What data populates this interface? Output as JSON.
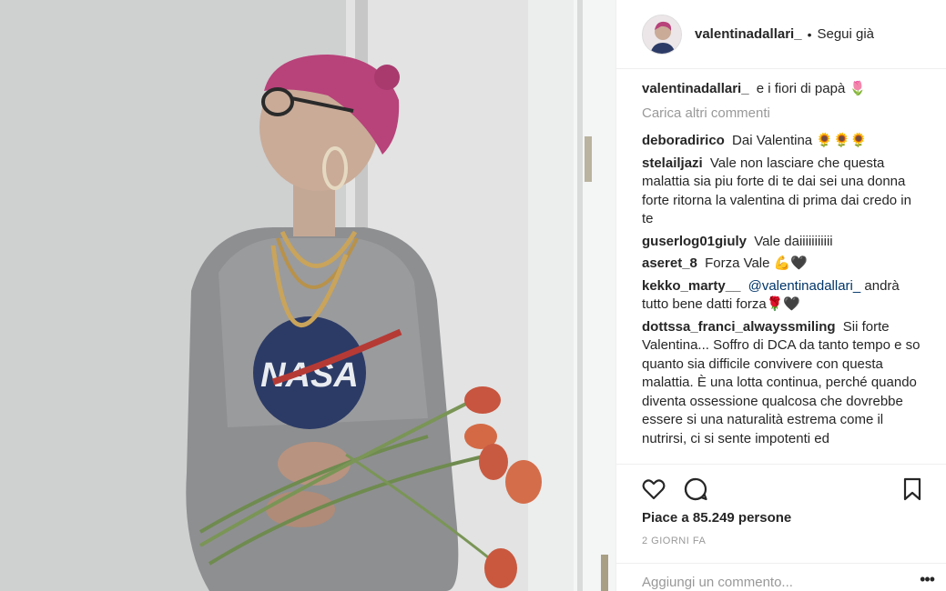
{
  "post": {
    "username": "valentinadallari_",
    "dot": "•",
    "follow_status": "Segui già"
  },
  "caption": {
    "username": "valentinadallari_",
    "text": "e i fiori di papà 🌷"
  },
  "load_more": "Carica altri commenti",
  "comments": [
    {
      "username": "deboradirico",
      "text": "Dai Valentina 🌻🌻🌻"
    },
    {
      "username": "stelailjazi",
      "text": "Vale non lasciare che questa malattia sia piu forte di te dai sei una donna forte ritorna la valentina di prima dai credo in te"
    },
    {
      "username": "guserlog01giuly",
      "text": "Vale daiiiiiiiiiii"
    },
    {
      "username": "aseret_8",
      "text": "Forza Vale 💪🖤"
    },
    {
      "username": "kekko_marty__",
      "mention": "@valentinadallari_",
      "text": "andrà tutto bene datti forza🌹🖤"
    },
    {
      "username": "dottssa_franci_alwayssmiling",
      "text": "Sii forte Valentina... Soffro di DCA da tanto tempo e so quanto sia difficile convivere con questa malattia. È una lotta continua, perché quando diventa ossessione qualcosa che dovrebbe essere si una naturalità estrema come il nutrirsi, ci si sente impotenti ed"
    }
  ],
  "likes_text": "Piace a 85.249 persone",
  "time_text": "2 GIORNI FA",
  "add_comment_placeholder": "Aggiungi un commento...",
  "options_glyph": "•••",
  "icons": {
    "like": "heart-icon",
    "comment": "comment-icon",
    "save": "bookmark-icon",
    "options": "more-options-icon"
  }
}
